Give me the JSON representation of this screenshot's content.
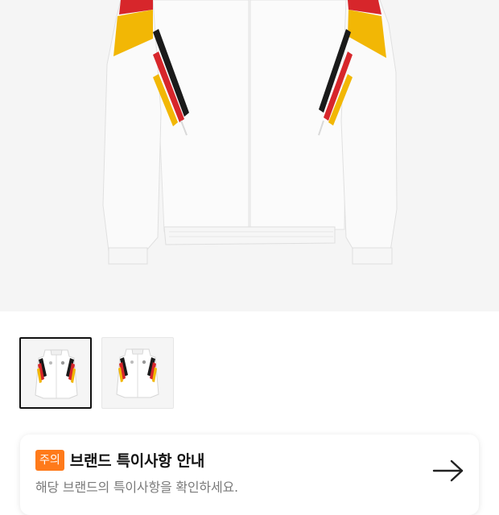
{
  "product": {
    "images": [
      {
        "name": "jacket-front-main"
      },
      {
        "name": "jacket-front-alt"
      }
    ],
    "selected_thumb": 0
  },
  "notice": {
    "badge": "주의",
    "title": "브랜드 특이사항 안내",
    "subtitle": "해당 브랜드의 특이사항을 확인하세요.",
    "icon": "arrow-right-icon"
  },
  "colors": {
    "badge": "#ff7a1a",
    "stripe_black": "#1a1a1a",
    "stripe_red": "#d7262b",
    "stripe_yellow": "#f2b705"
  }
}
